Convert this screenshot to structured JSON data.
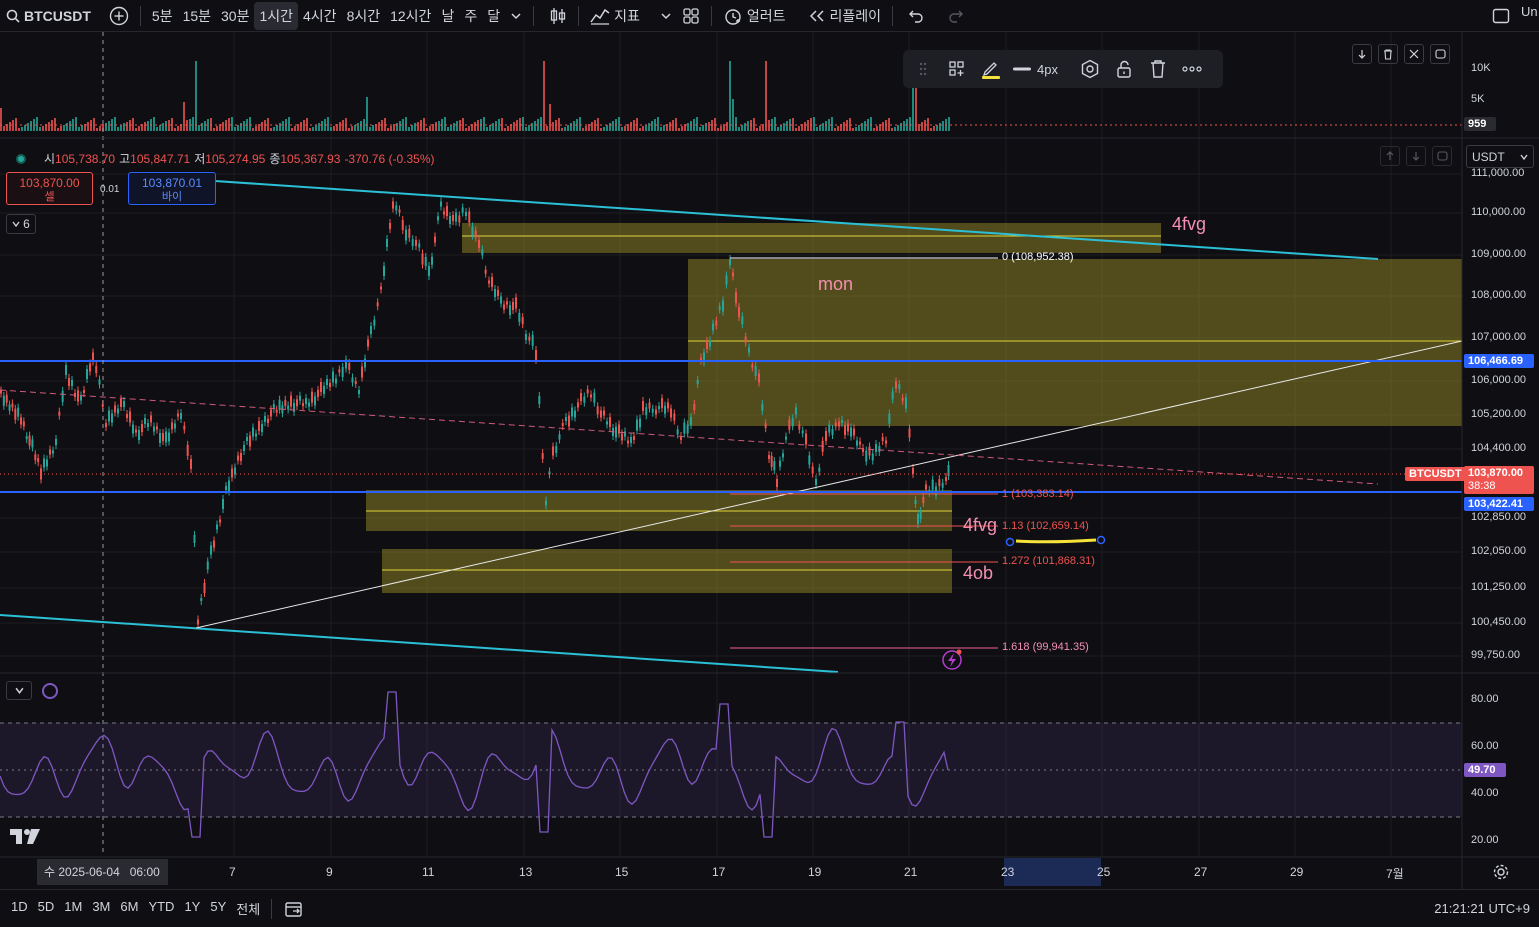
{
  "top": {
    "symbol": "BTCUSDT",
    "intervals": [
      "5분",
      "15분",
      "30분",
      "1시간",
      "4시간",
      "8시간",
      "12시간",
      "날",
      "주",
      "달"
    ],
    "active_interval": "1시간",
    "indicators_label": "지표",
    "alert_label": "얼러트",
    "replay_label": "리플레이",
    "right_cut": "Un"
  },
  "drawing_toolbar": {
    "width_label": "4px"
  },
  "ohlc": {
    "o_label": "시",
    "o": "105,738.70",
    "h_label": "고",
    "h": "105,847.71",
    "l_label": "저",
    "l": "105,274.95",
    "c_label": "종",
    "c": "105,367.93",
    "change": "-370.76 (-0.35%)"
  },
  "trade": {
    "sell_price": "103,870.00",
    "sell_label": "셀",
    "spread": "0.01",
    "buy_price": "103,870.01",
    "buy_label": "바이",
    "collapse_count": "6"
  },
  "currency": "USDT",
  "volume_axis": [
    "10K",
    "5K"
  ],
  "volume_current": "959",
  "price_axis": [
    "111,000.00",
    "110,000.00",
    "109,000.00",
    "108,000.00",
    "107,000.00",
    "106,000.00",
    "105,200.00",
    "104,400.00",
    "102,850.00",
    "102,050.00",
    "101,250.00",
    "100,450.00",
    "99,750.00"
  ],
  "price_tags": {
    "level_blue_upper": "106,466.69",
    "symbol_tag": "BTCUSDT",
    "last_price": "103,870.00",
    "countdown": "38:38",
    "level_blue_lower": "103,422.41"
  },
  "annotations": {
    "fvg_top": "4fvg",
    "mon": "mon",
    "fvg_mid": "4fvg",
    "ob": "4ob"
  },
  "fib": {
    "f0": "0 (108,952.38)",
    "f1": "1 (103,383.14)",
    "f113": "1.13 (102,659.14)",
    "f1272": "1.272 (101,868.31)",
    "f1618": "1.618 (99,941.35)"
  },
  "rsi_axis": [
    "80.00",
    "60.00",
    "40.00",
    "20.00"
  ],
  "rsi_value": "49.70",
  "time_axis": {
    "cursor_label": "수 2025-06-04   06:00",
    "ticks": [
      "7",
      "9",
      "11",
      "13",
      "15",
      "17",
      "19",
      "21",
      "23",
      "25",
      "27",
      "29",
      "7월"
    ]
  },
  "bottom": {
    "ranges": [
      "1D",
      "5D",
      "1M",
      "3M",
      "6M",
      "YTD",
      "1Y",
      "5Y",
      "전체"
    ],
    "clock": "21:21:21 UTC+9"
  },
  "colors": {
    "bg": "#0f0f13",
    "up": "#26a69a",
    "down": "#ef5350",
    "zone": "#d4c43a",
    "cyan": "#2bc0d6",
    "blue": "#2962ff",
    "pink": "#f06292",
    "rsi": "#7e57c2"
  }
}
